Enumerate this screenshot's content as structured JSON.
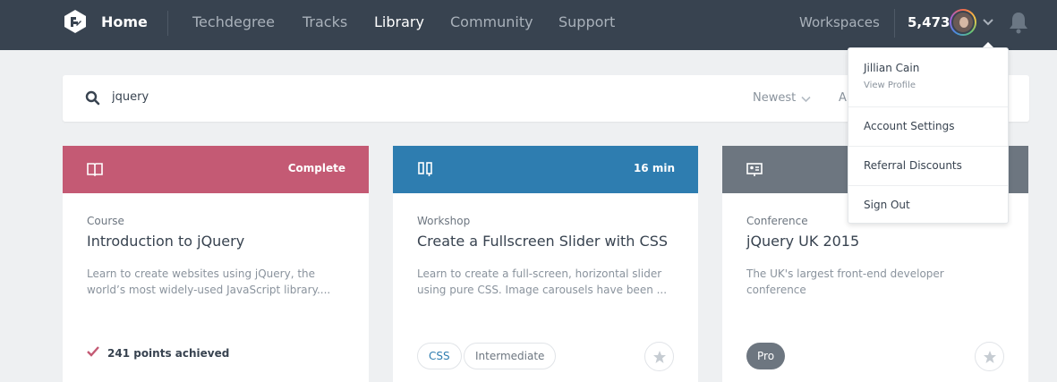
{
  "nav": {
    "home": "Home",
    "links": [
      "Techdegree",
      "Tracks",
      "Library",
      "Community",
      "Support"
    ],
    "active": "Library",
    "workspaces": "Workspaces",
    "points": "5,473"
  },
  "search": {
    "value": "jquery",
    "sort_label": "Newest",
    "second_filter_partial": "A"
  },
  "cards": [
    {
      "header_label": "Complete",
      "header_color": "#c45a74",
      "icon": "book-icon",
      "type": "Course",
      "title": "Introduction to jQuery",
      "desc_lines": [
        "Learn to create websites using jQuery, the",
        "world’s most widely-used JavaScript library...."
      ],
      "achieved": "241 points achieved"
    },
    {
      "header_label": "16 min",
      "header_color": "#2e7db0",
      "icon": "workshop-icon",
      "type": "Workshop",
      "title": "Create a Fullscreen Slider with CSS",
      "desc_lines": [
        "Learn to create a full-screen, horizontal slider",
        "using pure CSS. Image carousels have been ..."
      ],
      "tags": [
        "CSS",
        "Intermediate"
      ]
    },
    {
      "header_label": "",
      "header_color": "#6d7680",
      "icon": "conference-icon",
      "type": "Conference",
      "title": "jQuery UK 2015",
      "desc_lines": [
        "The UK's largest front-end developer",
        "conference"
      ],
      "tags": [
        "Pro"
      ]
    }
  ],
  "dropdown": {
    "name": "Jillian Cain",
    "profile": "View Profile",
    "items": [
      "Account Settings",
      "Referral Discounts",
      "Sign Out"
    ]
  },
  "colors": {
    "nav_bg": "#384350",
    "page_bg": "#eef0f2",
    "css_tag": "#2e7db0"
  }
}
